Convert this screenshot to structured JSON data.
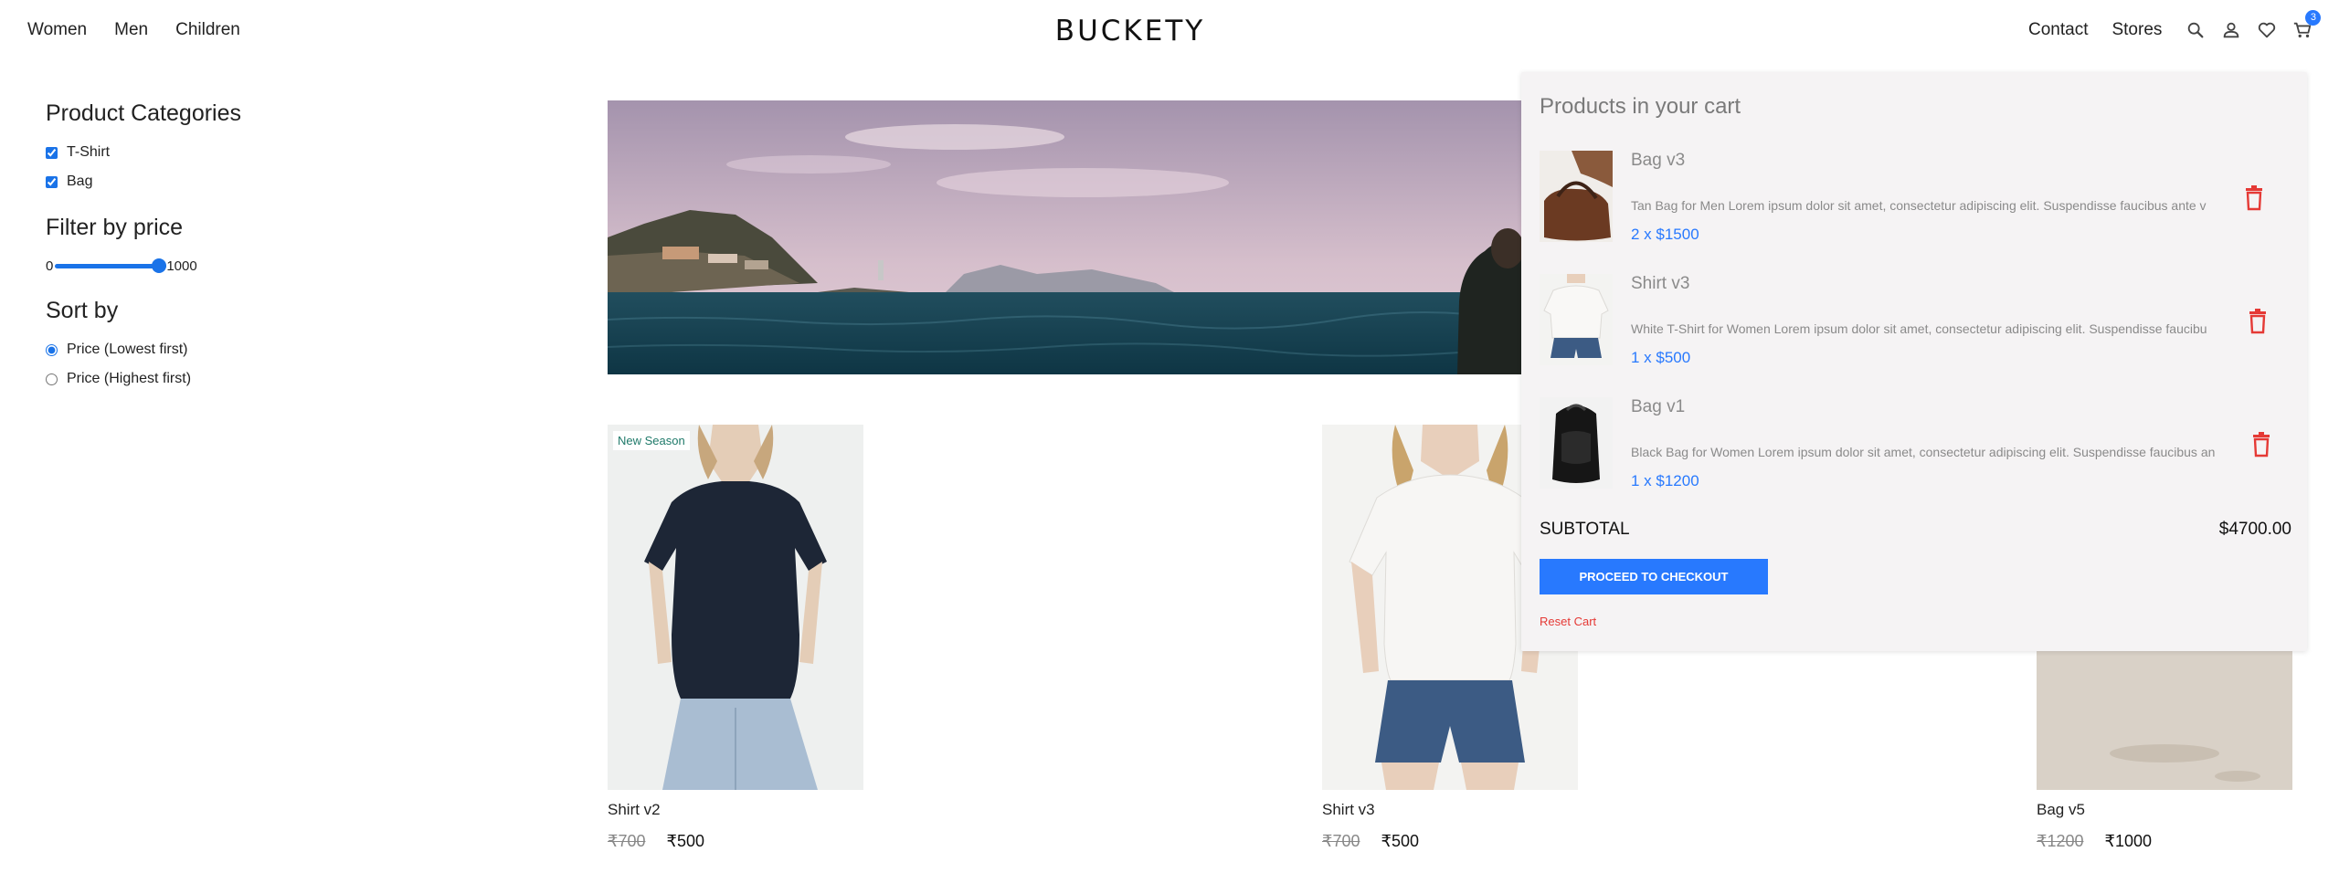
{
  "nav": {
    "links": [
      "Women",
      "Men",
      "Children"
    ],
    "brand": "BUCKETY",
    "right_links": [
      "Contact",
      "Stores"
    ],
    "icons": [
      "search-icon",
      "user-icon",
      "heart-icon",
      "cart-icon"
    ],
    "cart_count": "3"
  },
  "sidebar": {
    "categories_heading": "Product Categories",
    "categories": [
      {
        "label": "T-Shirt",
        "checked": true
      },
      {
        "label": "Bag",
        "checked": true
      }
    ],
    "price_heading": "Filter by price",
    "price_min": "0",
    "price_max": "1000",
    "sort_heading": "Sort by",
    "sort_options": [
      {
        "label": "Price (Lowest first)",
        "selected": true
      },
      {
        "label": "Price (Highest first)",
        "selected": false
      }
    ]
  },
  "products": [
    {
      "title": "Shirt v2",
      "old_price": "₹700",
      "price": "₹500",
      "badge": "New Season"
    },
    {
      "title": "Shirt v3",
      "old_price": "₹700",
      "price": "₹500",
      "badge": ""
    },
    {
      "title": "Bag v5",
      "old_price": "₹1200",
      "price": "₹1000",
      "badge": ""
    }
  ],
  "cart": {
    "title": "Products in your cart",
    "items": [
      {
        "name": "Bag v3",
        "desc": "Tan Bag for Men Lorem ipsum dolor sit amet, consectetur adipiscing elit. Suspendisse faucibus ante v",
        "qty": "2 x $1500"
      },
      {
        "name": "Shirt v3",
        "desc": "White T-Shirt for Women Lorem ipsum dolor sit amet, consectetur adipiscing elit. Suspendisse faucibu",
        "qty": "1 x $500"
      },
      {
        "name": "Bag v1",
        "desc": "Black Bag for Women Lorem ipsum dolor sit amet, consectetur adipiscing elit. Suspendisse faucibus an",
        "qty": "1 x $1200"
      }
    ],
    "subtotal_label": "SUBTOTAL",
    "subtotal_value": "$4700.00",
    "checkout_label": "PROCEED TO CHECKOUT",
    "reset_label": "Reset Cart"
  },
  "colors": {
    "accent": "#2879fe",
    "delete": "#e53935",
    "cart_bg": "#f5f3f4"
  }
}
